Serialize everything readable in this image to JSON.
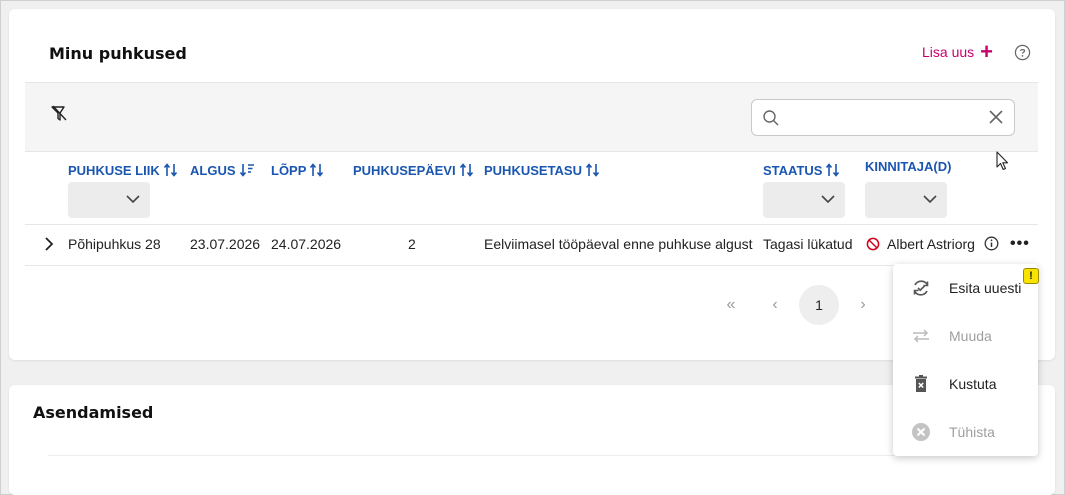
{
  "section1": {
    "title": "Minu puhkused",
    "add_new_label": "Lisa uus",
    "add_new_icon": "plus-icon",
    "help_icon": "help-circle-icon",
    "filter_icon": "filter-off-icon",
    "search": {
      "placeholder": "",
      "value": ""
    },
    "columns": [
      {
        "label": "PUHKUSE LIIK",
        "sort": "both"
      },
      {
        "label": "ALGUS",
        "sort": "descending"
      },
      {
        "label": "LÕPP",
        "sort": "both"
      },
      {
        "label": "PUHKUSEPÄEVI",
        "sort": "both"
      },
      {
        "label": "PUHKUSETASU",
        "sort": "both"
      },
      {
        "label": "STAATUS",
        "sort": "both"
      },
      {
        "label": "KINNITAJA(D)",
        "sort": "none"
      }
    ],
    "rows": [
      {
        "type": "Põhipuhkus 28",
        "start": "23.07.2026",
        "end": "24.07.2026",
        "days": "2",
        "pay": "Eelviimasel tööpäeval enne puhkuse algust",
        "status": "Tagasi lükatud",
        "approver": "Albert Astriorg"
      }
    ],
    "pagination": {
      "first": "«",
      "prev": "‹",
      "current": "1",
      "next": "›"
    }
  },
  "row_menu": {
    "items": [
      {
        "label": "Esita uuesti",
        "icon": "resubmit-icon",
        "enabled": true
      },
      {
        "label": "Muuda",
        "icon": "swap-arrows-icon",
        "enabled": false
      },
      {
        "label": "Kustuta",
        "icon": "trash-icon",
        "enabled": true
      },
      {
        "label": "Tühista",
        "icon": "cancel-circle-icon",
        "enabled": false
      }
    ],
    "warning_badge": "!"
  },
  "section2": {
    "title": "Asendamised"
  },
  "colors": {
    "accent": "#c8006e",
    "header_blue": "#1a56b0",
    "danger": "#d0021b"
  }
}
